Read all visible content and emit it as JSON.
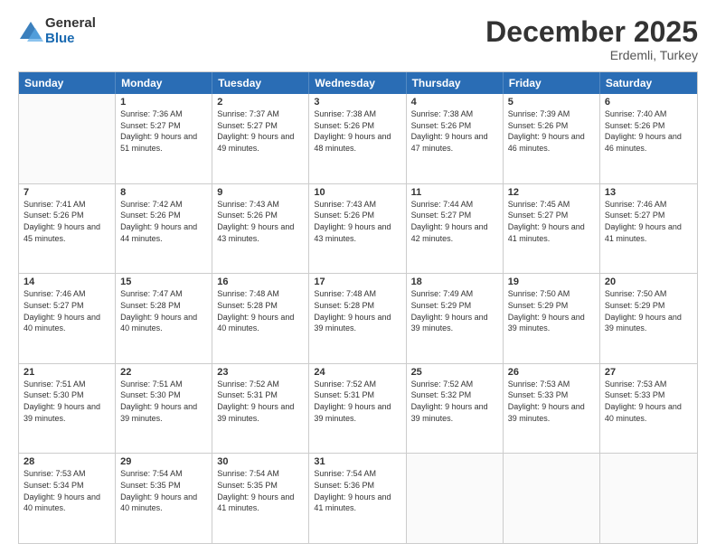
{
  "logo": {
    "general": "General",
    "blue": "Blue"
  },
  "title": "December 2025",
  "location": "Erdemli, Turkey",
  "days": [
    "Sunday",
    "Monday",
    "Tuesday",
    "Wednesday",
    "Thursday",
    "Friday",
    "Saturday"
  ],
  "weeks": [
    [
      {
        "day": "",
        "empty": true
      },
      {
        "day": "1",
        "sunrise": "7:36 AM",
        "sunset": "5:27 PM",
        "daylight": "9 hours and 51 minutes."
      },
      {
        "day": "2",
        "sunrise": "7:37 AM",
        "sunset": "5:27 PM",
        "daylight": "9 hours and 49 minutes."
      },
      {
        "day": "3",
        "sunrise": "7:38 AM",
        "sunset": "5:26 PM",
        "daylight": "9 hours and 48 minutes."
      },
      {
        "day": "4",
        "sunrise": "7:38 AM",
        "sunset": "5:26 PM",
        "daylight": "9 hours and 47 minutes."
      },
      {
        "day": "5",
        "sunrise": "7:39 AM",
        "sunset": "5:26 PM",
        "daylight": "9 hours and 46 minutes."
      },
      {
        "day": "6",
        "sunrise": "7:40 AM",
        "sunset": "5:26 PM",
        "daylight": "9 hours and 46 minutes."
      }
    ],
    [
      {
        "day": "7",
        "sunrise": "7:41 AM",
        "sunset": "5:26 PM",
        "daylight": "9 hours and 45 minutes."
      },
      {
        "day": "8",
        "sunrise": "7:42 AM",
        "sunset": "5:26 PM",
        "daylight": "9 hours and 44 minutes."
      },
      {
        "day": "9",
        "sunrise": "7:43 AM",
        "sunset": "5:26 PM",
        "daylight": "9 hours and 43 minutes."
      },
      {
        "day": "10",
        "sunrise": "7:43 AM",
        "sunset": "5:26 PM",
        "daylight": "9 hours and 43 minutes."
      },
      {
        "day": "11",
        "sunrise": "7:44 AM",
        "sunset": "5:27 PM",
        "daylight": "9 hours and 42 minutes."
      },
      {
        "day": "12",
        "sunrise": "7:45 AM",
        "sunset": "5:27 PM",
        "daylight": "9 hours and 41 minutes."
      },
      {
        "day": "13",
        "sunrise": "7:46 AM",
        "sunset": "5:27 PM",
        "daylight": "9 hours and 41 minutes."
      }
    ],
    [
      {
        "day": "14",
        "sunrise": "7:46 AM",
        "sunset": "5:27 PM",
        "daylight": "9 hours and 40 minutes."
      },
      {
        "day": "15",
        "sunrise": "7:47 AM",
        "sunset": "5:28 PM",
        "daylight": "9 hours and 40 minutes."
      },
      {
        "day": "16",
        "sunrise": "7:48 AM",
        "sunset": "5:28 PM",
        "daylight": "9 hours and 40 minutes."
      },
      {
        "day": "17",
        "sunrise": "7:48 AM",
        "sunset": "5:28 PM",
        "daylight": "9 hours and 39 minutes."
      },
      {
        "day": "18",
        "sunrise": "7:49 AM",
        "sunset": "5:29 PM",
        "daylight": "9 hours and 39 minutes."
      },
      {
        "day": "19",
        "sunrise": "7:50 AM",
        "sunset": "5:29 PM",
        "daylight": "9 hours and 39 minutes."
      },
      {
        "day": "20",
        "sunrise": "7:50 AM",
        "sunset": "5:29 PM",
        "daylight": "9 hours and 39 minutes."
      }
    ],
    [
      {
        "day": "21",
        "sunrise": "7:51 AM",
        "sunset": "5:30 PM",
        "daylight": "9 hours and 39 minutes."
      },
      {
        "day": "22",
        "sunrise": "7:51 AM",
        "sunset": "5:30 PM",
        "daylight": "9 hours and 39 minutes."
      },
      {
        "day": "23",
        "sunrise": "7:52 AM",
        "sunset": "5:31 PM",
        "daylight": "9 hours and 39 minutes."
      },
      {
        "day": "24",
        "sunrise": "7:52 AM",
        "sunset": "5:31 PM",
        "daylight": "9 hours and 39 minutes."
      },
      {
        "day": "25",
        "sunrise": "7:52 AM",
        "sunset": "5:32 PM",
        "daylight": "9 hours and 39 minutes."
      },
      {
        "day": "26",
        "sunrise": "7:53 AM",
        "sunset": "5:33 PM",
        "daylight": "9 hours and 39 minutes."
      },
      {
        "day": "27",
        "sunrise": "7:53 AM",
        "sunset": "5:33 PM",
        "daylight": "9 hours and 40 minutes."
      }
    ],
    [
      {
        "day": "28",
        "sunrise": "7:53 AM",
        "sunset": "5:34 PM",
        "daylight": "9 hours and 40 minutes."
      },
      {
        "day": "29",
        "sunrise": "7:54 AM",
        "sunset": "5:35 PM",
        "daylight": "9 hours and 40 minutes."
      },
      {
        "day": "30",
        "sunrise": "7:54 AM",
        "sunset": "5:35 PM",
        "daylight": "9 hours and 41 minutes."
      },
      {
        "day": "31",
        "sunrise": "7:54 AM",
        "sunset": "5:36 PM",
        "daylight": "9 hours and 41 minutes."
      },
      {
        "day": "",
        "empty": true
      },
      {
        "day": "",
        "empty": true
      },
      {
        "day": "",
        "empty": true
      }
    ]
  ],
  "labels": {
    "sunrise": "Sunrise:",
    "sunset": "Sunset:",
    "daylight": "Daylight:"
  }
}
